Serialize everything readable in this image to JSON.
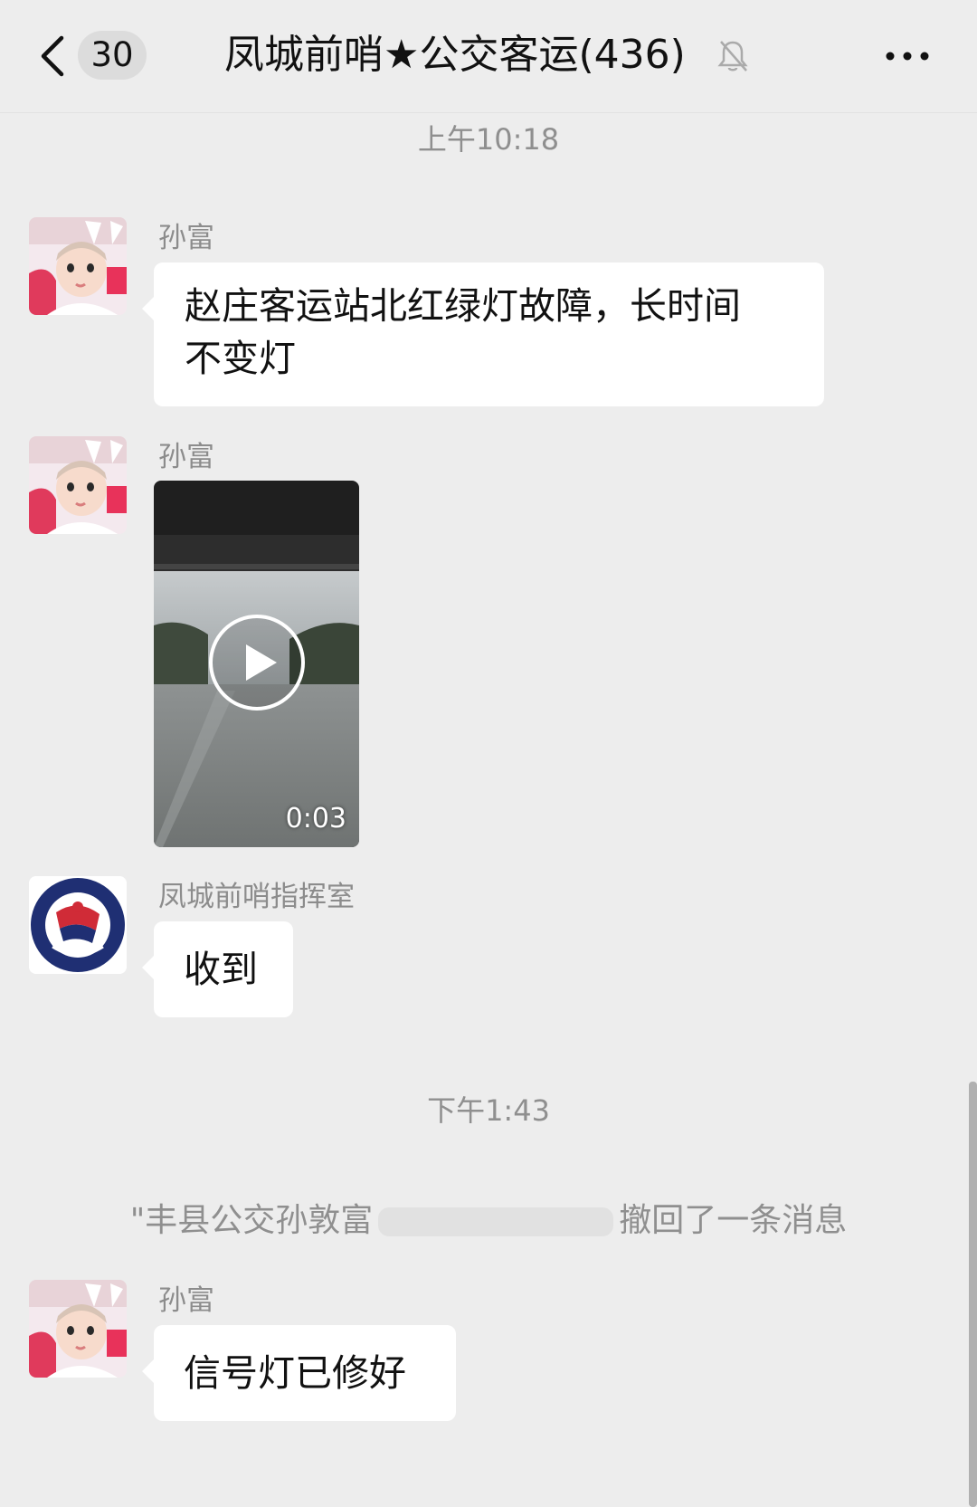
{
  "header": {
    "unread_count": "30",
    "title": "凤城前哨★公交客运(436)",
    "back_icon": "chevron-left-icon",
    "mute_icon": "bell-off-icon",
    "more_icon": "more-dots-icon"
  },
  "timestamps": [
    "上午10:18",
    "下午1:43"
  ],
  "messages": [
    {
      "sender": "孙富",
      "text_lines": [
        "赵庄客运站北红绿灯故障，长时间",
        "不变灯"
      ]
    },
    {
      "sender": "孙富",
      "video_duration": "0:03"
    },
    {
      "sender": "凤城前哨指挥室",
      "text": "收到"
    },
    {
      "sender": "孙富",
      "text": "信号灯已修好"
    }
  ],
  "system_message": {
    "prefix": "\"丰县公交孙敦富",
    "suffix": "撤回了一条消息"
  },
  "colors": {
    "background": "#ededed",
    "bubble": "#ffffff",
    "meta_text": "#8f8f8f"
  }
}
